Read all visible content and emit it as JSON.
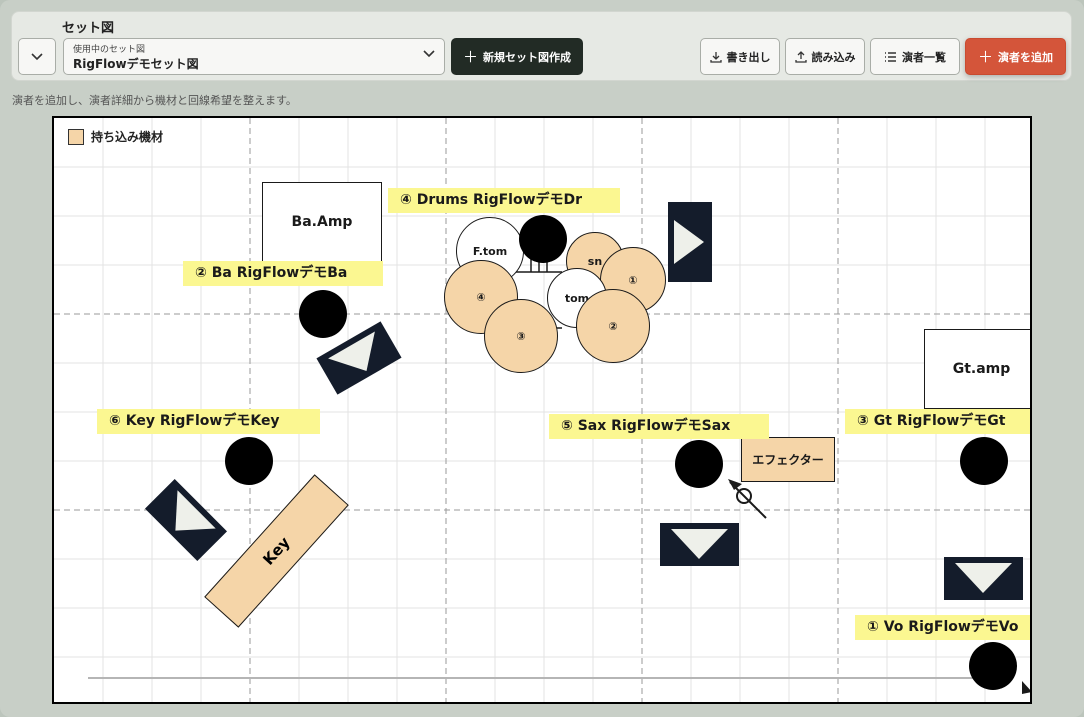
{
  "header": {
    "section_title": "セット図",
    "select_label": "使用中のセット図",
    "select_value": "RigFlowデモセット図",
    "new_button": "新規セット図作成",
    "export_button": "書き出し",
    "import_button": "読み込み",
    "members_button": "演者一覧",
    "add_member_button": "演者を追加"
  },
  "hint": "演者を追加し、演者詳細から機材と回線希望を整えます。",
  "legend": {
    "label": "持ち込み機材",
    "color": "#f5d5a8"
  },
  "stage": {
    "amps": {
      "bass": "Ba.Amp",
      "guitar": "Gt.amp"
    },
    "effector": "エフェクター",
    "keyboard": "Key",
    "performers": {
      "drums": "④ Drums RigFlowデモDr",
      "bass": "② Ba RigFlowデモBa",
      "key": "⑥ Key RigFlowデモKey",
      "sax": "⑤ Sax RigFlowデモSax",
      "gt": "③ Gt RigFlowデモGt",
      "vo": "① Vo RigFlowデモVo"
    },
    "drums": {
      "ftom": "F.tom",
      "sn": "sn",
      "tom": "tom",
      "cymbal_1": "①",
      "cymbal_2": "②",
      "cymbal_3": "③",
      "cymbal_4": "④"
    }
  },
  "colors": {
    "accent": "#d4553a",
    "dark": "#222b25",
    "monitor": "#141c2b",
    "label_bg": "#fbf791",
    "equipment": "#f5d5a8"
  }
}
